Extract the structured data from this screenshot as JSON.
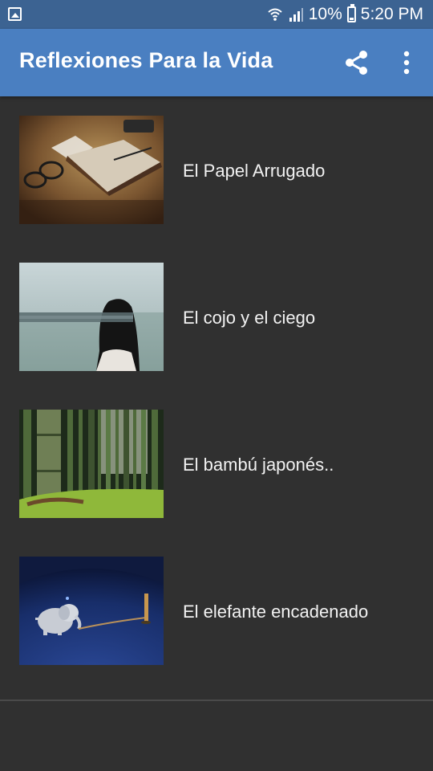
{
  "status_bar": {
    "battery_percent": "10%",
    "time": "5:20 PM",
    "icons": [
      "image-notification-icon",
      "wifi-icon",
      "signal-icon",
      "battery-icon"
    ]
  },
  "app_bar": {
    "title": "Reflexiones Para la Vida",
    "actions": [
      "share-icon",
      "more-options-icon"
    ],
    "color": "#4a7fc1"
  },
  "items": [
    {
      "title": "El Papel Arrugado",
      "thumbnail": "notebook-with-glasses"
    },
    {
      "title": "El cojo y el ciego",
      "thumbnail": "blindfolded-woman-by-sea"
    },
    {
      "title": "El bambú japonés..",
      "thumbnail": "bamboo-forest"
    },
    {
      "title": "El elefante encadenado",
      "thumbnail": "chained-baby-elephant"
    }
  ]
}
